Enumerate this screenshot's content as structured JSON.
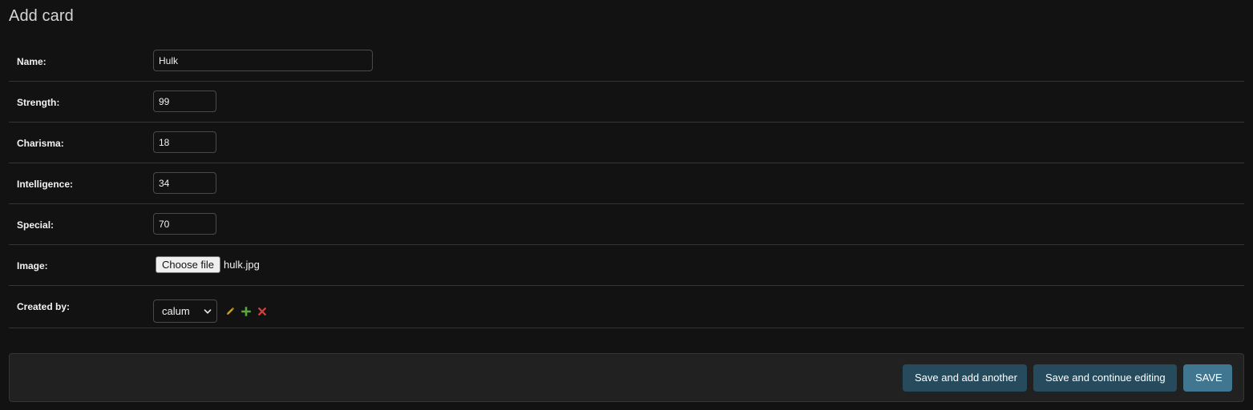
{
  "page": {
    "title": "Add card"
  },
  "fields": {
    "name": {
      "label": "Name:",
      "value": "Hulk"
    },
    "strength": {
      "label": "Strength:",
      "value": "99"
    },
    "charisma": {
      "label": "Charisma:",
      "value": "18"
    },
    "intelligence": {
      "label": "Intelligence:",
      "value": "34"
    },
    "special": {
      "label": "Special:",
      "value": "70"
    },
    "image": {
      "label": "Image:",
      "button_label": "Choose file",
      "file_name": "hulk.jpg"
    },
    "created_by": {
      "label": "Created by:",
      "selected": "calum",
      "icons": [
        "pencil-icon",
        "plus-icon",
        "delete-icon"
      ]
    }
  },
  "submit": {
    "save_add_another": "Save and add another",
    "save_continue": "Save and continue editing",
    "save": "SAVE"
  },
  "colors": {
    "background": "#121212",
    "submit_row": "#212121",
    "primary_button": "#417690",
    "secondary_button": "#264b5d",
    "edit_icon": "#c7a327",
    "add_icon": "#58a83f",
    "delete_icon": "#d03f3f"
  }
}
